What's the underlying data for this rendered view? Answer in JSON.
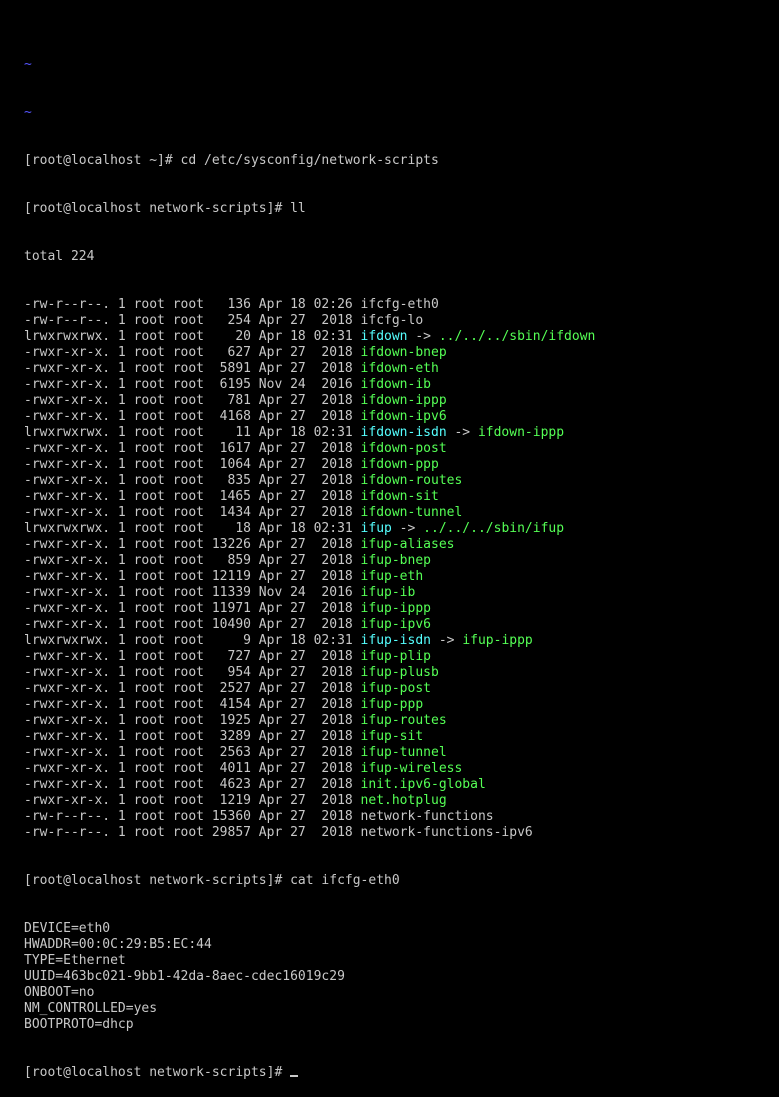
{
  "terminal": {
    "colors": {
      "background": "#000000",
      "text": "#c8c8c8",
      "tilde": "#5555ff",
      "executable": "#55ff55",
      "symlink": "#55ffff"
    },
    "tildes": [
      "~",
      "~"
    ],
    "prompt1": "[root@localhost ~]# cd /etc/sysconfig/network-scripts",
    "prompt2": "[root@localhost network-scripts]# ll",
    "total": "total 224",
    "listing": [
      {
        "info": "-rw-r--r--. 1 root root   136 Apr 18 02:26 ",
        "name": "ifcfg-eth0",
        "kind": "plain",
        "target": ""
      },
      {
        "info": "-rw-r--r--. 1 root root   254 Apr 27  2018 ",
        "name": "ifcfg-lo",
        "kind": "plain",
        "target": ""
      },
      {
        "info": "lrwxrwxrwx. 1 root root    20 Apr 18 02:31 ",
        "name": "ifdown",
        "kind": "link",
        "target": "../../../sbin/ifdown"
      },
      {
        "info": "-rwxr-xr-x. 1 root root   627 Apr 27  2018 ",
        "name": "ifdown-bnep",
        "kind": "exec",
        "target": ""
      },
      {
        "info": "-rwxr-xr-x. 1 root root  5891 Apr 27  2018 ",
        "name": "ifdown-eth",
        "kind": "exec",
        "target": ""
      },
      {
        "info": "-rwxr-xr-x. 1 root root  6195 Nov 24  2016 ",
        "name": "ifdown-ib",
        "kind": "exec",
        "target": ""
      },
      {
        "info": "-rwxr-xr-x. 1 root root   781 Apr 27  2018 ",
        "name": "ifdown-ippp",
        "kind": "exec",
        "target": ""
      },
      {
        "info": "-rwxr-xr-x. 1 root root  4168 Apr 27  2018 ",
        "name": "ifdown-ipv6",
        "kind": "exec",
        "target": ""
      },
      {
        "info": "lrwxrwxrwx. 1 root root    11 Apr 18 02:31 ",
        "name": "ifdown-isdn",
        "kind": "link",
        "target": "ifdown-ippp"
      },
      {
        "info": "-rwxr-xr-x. 1 root root  1617 Apr 27  2018 ",
        "name": "ifdown-post",
        "kind": "exec",
        "target": ""
      },
      {
        "info": "-rwxr-xr-x. 1 root root  1064 Apr 27  2018 ",
        "name": "ifdown-ppp",
        "kind": "exec",
        "target": ""
      },
      {
        "info": "-rwxr-xr-x. 1 root root   835 Apr 27  2018 ",
        "name": "ifdown-routes",
        "kind": "exec",
        "target": ""
      },
      {
        "info": "-rwxr-xr-x. 1 root root  1465 Apr 27  2018 ",
        "name": "ifdown-sit",
        "kind": "exec",
        "target": ""
      },
      {
        "info": "-rwxr-xr-x. 1 root root  1434 Apr 27  2018 ",
        "name": "ifdown-tunnel",
        "kind": "exec",
        "target": ""
      },
      {
        "info": "lrwxrwxrwx. 1 root root    18 Apr 18 02:31 ",
        "name": "ifup",
        "kind": "link",
        "target": "../../../sbin/ifup"
      },
      {
        "info": "-rwxr-xr-x. 1 root root 13226 Apr 27  2018 ",
        "name": "ifup-aliases",
        "kind": "exec",
        "target": ""
      },
      {
        "info": "-rwxr-xr-x. 1 root root   859 Apr 27  2018 ",
        "name": "ifup-bnep",
        "kind": "exec",
        "target": ""
      },
      {
        "info": "-rwxr-xr-x. 1 root root 12119 Apr 27  2018 ",
        "name": "ifup-eth",
        "kind": "exec",
        "target": ""
      },
      {
        "info": "-rwxr-xr-x. 1 root root 11339 Nov 24  2016 ",
        "name": "ifup-ib",
        "kind": "exec",
        "target": ""
      },
      {
        "info": "-rwxr-xr-x. 1 root root 11971 Apr 27  2018 ",
        "name": "ifup-ippp",
        "kind": "exec",
        "target": ""
      },
      {
        "info": "-rwxr-xr-x. 1 root root 10490 Apr 27  2018 ",
        "name": "ifup-ipv6",
        "kind": "exec",
        "target": ""
      },
      {
        "info": "lrwxrwxrwx. 1 root root     9 Apr 18 02:31 ",
        "name": "ifup-isdn",
        "kind": "link",
        "target": "ifup-ippp"
      },
      {
        "info": "-rwxr-xr-x. 1 root root   727 Apr 27  2018 ",
        "name": "ifup-plip",
        "kind": "exec",
        "target": ""
      },
      {
        "info": "-rwxr-xr-x. 1 root root   954 Apr 27  2018 ",
        "name": "ifup-plusb",
        "kind": "exec",
        "target": ""
      },
      {
        "info": "-rwxr-xr-x. 1 root root  2527 Apr 27  2018 ",
        "name": "ifup-post",
        "kind": "exec",
        "target": ""
      },
      {
        "info": "-rwxr-xr-x. 1 root root  4154 Apr 27  2018 ",
        "name": "ifup-ppp",
        "kind": "exec",
        "target": ""
      },
      {
        "info": "-rwxr-xr-x. 1 root root  1925 Apr 27  2018 ",
        "name": "ifup-routes",
        "kind": "exec",
        "target": ""
      },
      {
        "info": "-rwxr-xr-x. 1 root root  3289 Apr 27  2018 ",
        "name": "ifup-sit",
        "kind": "exec",
        "target": ""
      },
      {
        "info": "-rwxr-xr-x. 1 root root  2563 Apr 27  2018 ",
        "name": "ifup-tunnel",
        "kind": "exec",
        "target": ""
      },
      {
        "info": "-rwxr-xr-x. 1 root root  4011 Apr 27  2018 ",
        "name": "ifup-wireless",
        "kind": "exec",
        "target": ""
      },
      {
        "info": "-rwxr-xr-x. 1 root root  4623 Apr 27  2018 ",
        "name": "init.ipv6-global",
        "kind": "exec",
        "target": ""
      },
      {
        "info": "-rwxr-xr-x. 1 root root  1219 Apr 27  2018 ",
        "name": "net.hotplug",
        "kind": "exec",
        "target": ""
      },
      {
        "info": "-rw-r--r--. 1 root root 15360 Apr 27  2018 ",
        "name": "network-functions",
        "kind": "plain",
        "target": ""
      },
      {
        "info": "-rw-r--r--. 1 root root 29857 Apr 27  2018 ",
        "name": "network-functions-ipv6",
        "kind": "plain",
        "target": ""
      }
    ],
    "prompt3": "[root@localhost network-scripts]# cat ifcfg-eth0",
    "config_lines": [
      "DEVICE=eth0",
      "HWADDR=00:0C:29:B5:EC:44",
      "TYPE=Ethernet",
      "UUID=463bc021-9bb1-42da-8aec-cdec16019c29",
      "ONBOOT=no",
      "NM_CONTROLLED=yes",
      "BOOTPROTO=dhcp"
    ],
    "prompt4": "[root@localhost network-scripts]# "
  }
}
